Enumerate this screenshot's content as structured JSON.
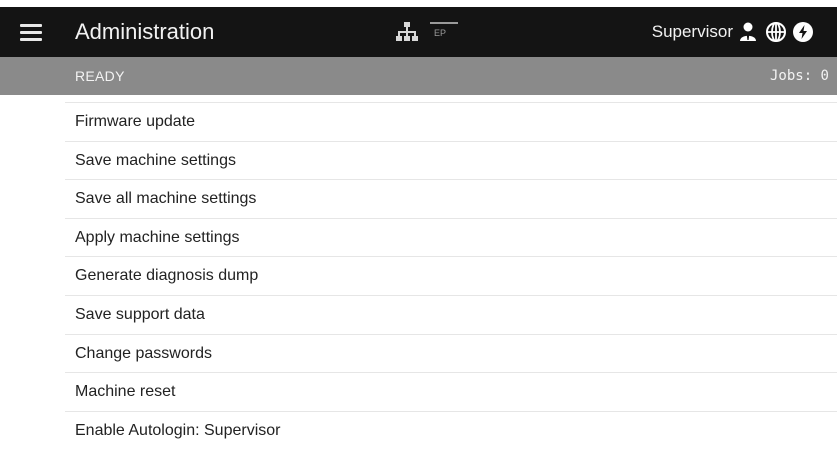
{
  "header": {
    "menu_icon": "hamburger-menu-icon",
    "title": "Administration",
    "network_icon": "network-topology-icon",
    "ep_label": "EP",
    "user_name": "Supervisor",
    "user_icon": "user-icon",
    "language_icon": "globe-icon",
    "power_icon": "power-icon",
    "colors": {
      "header_bg": "#141414",
      "status_bg": "#8a8a8a"
    }
  },
  "status": {
    "state": "READY",
    "jobs": "Jobs: 0"
  },
  "menu": {
    "items": [
      {
        "label": "Firmware update"
      },
      {
        "label": "Save machine settings"
      },
      {
        "label": "Save all machine settings"
      },
      {
        "label": "Apply machine settings"
      },
      {
        "label": "Generate diagnosis dump"
      },
      {
        "label": "Save support data"
      },
      {
        "label": "Change passwords"
      },
      {
        "label": "Machine reset"
      },
      {
        "label": "Enable Autologin: Supervisor"
      }
    ]
  }
}
